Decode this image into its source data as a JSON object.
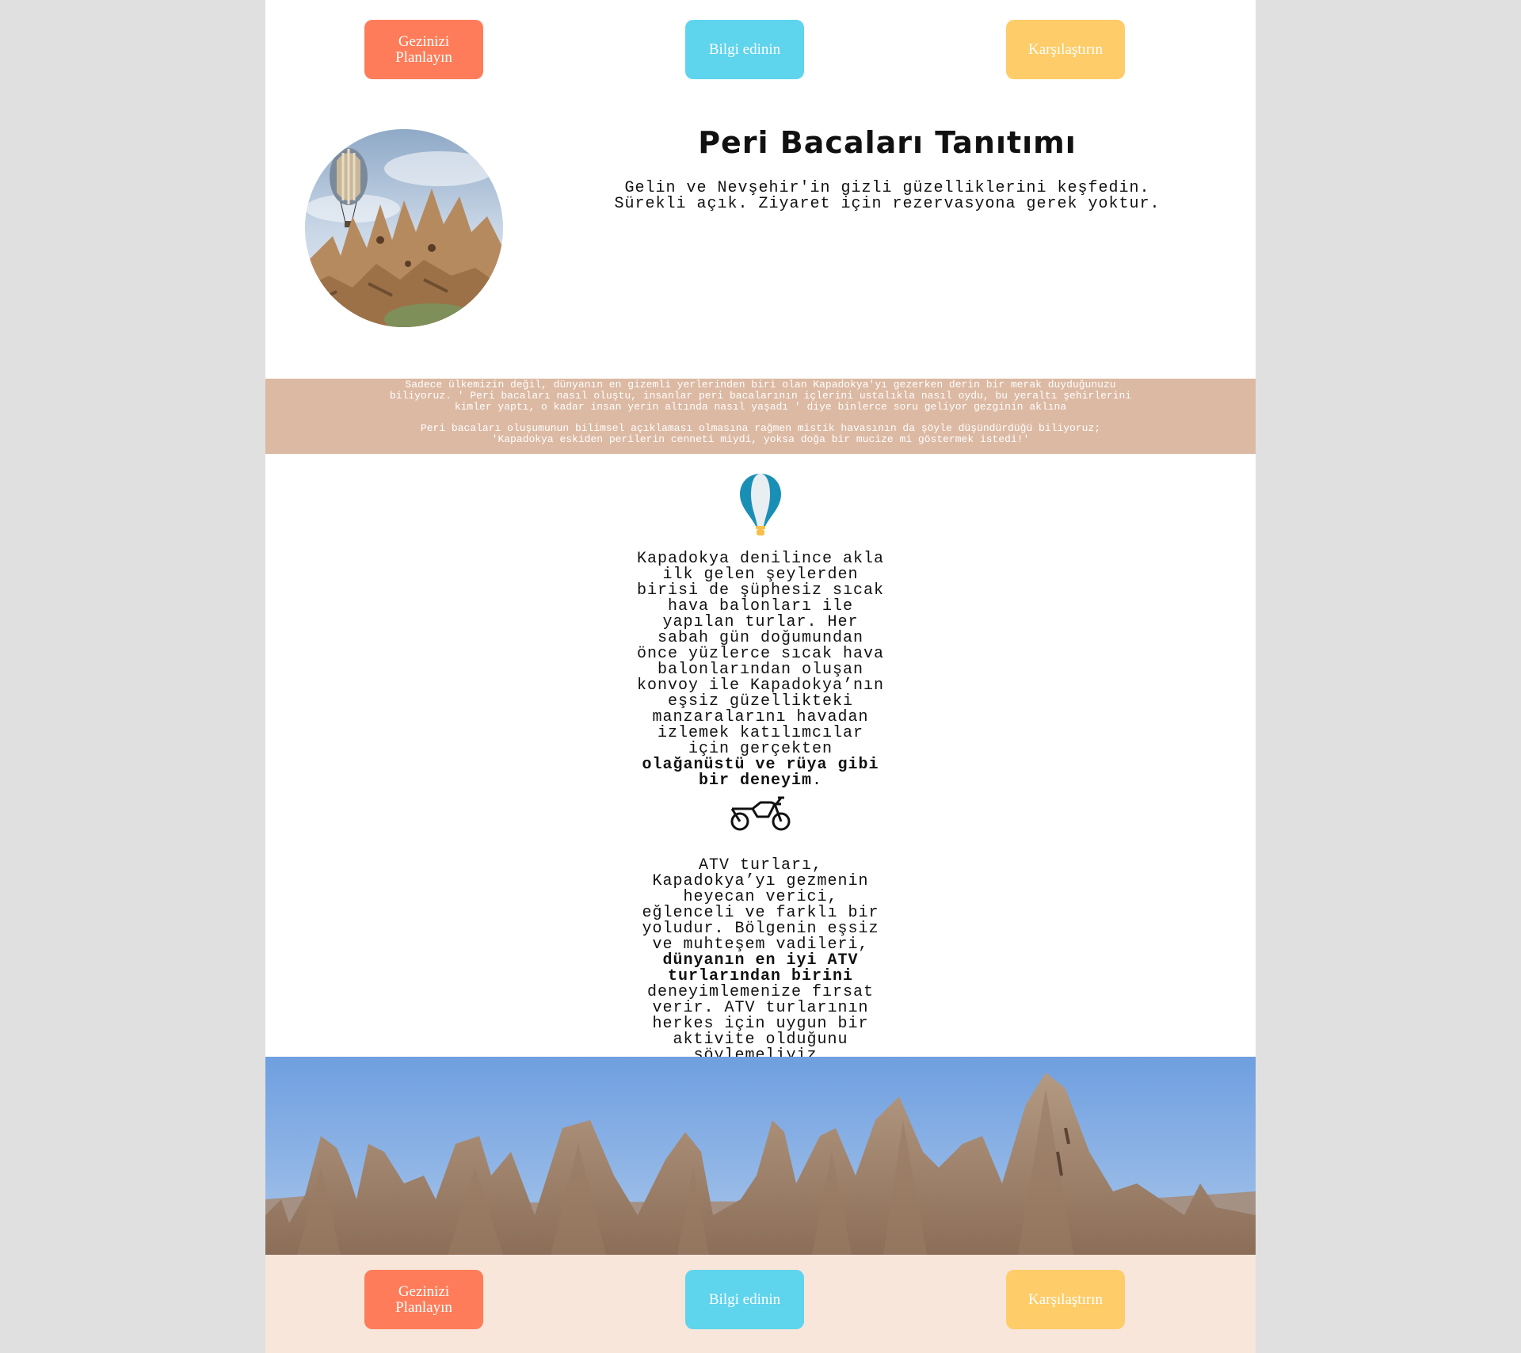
{
  "nav": {
    "plan_label": "Gezinizi Planlayın",
    "info_label": "Bilgi edinin",
    "compare_label": "Karşılaştırın"
  },
  "hero": {
    "title": "Peri Bacaları Tanıtımı",
    "subtitle_line1": "Gelin ve Nevşehir'in gizli güzelliklerini keşfedin.",
    "subtitle_line2": "Sürekli açık. Ziyaret için rezervasyona gerek yoktur.",
    "image_icon": "hot-air-balloon-over-fairy-chimneys"
  },
  "banner": {
    "paragraph1": "Sadece ülkemizin değil, dünyanın en gizemli yerlerinden biri olan Kapadokya'yı gezerken derin bir merak duyduğunuzu biliyoruz. ' Peri bacaları nasıl oluştu, insanlar peri bacalarının içlerini ustalıkla nasıl oydu, bu yeraltı şehirlerini kimler yaptı, o kadar insan yerin altında nasıl yaşadı ' diye binlerce soru geliyor gezginin aklına",
    "paragraph2_line1": "Peri bacaları oluşumunun bilimsel açıklaması olmasına rağmen mistik havasının da şöyle düşündürdüğü biliyoruz;",
    "paragraph2_line2": "'Kapadokya eskiden perilerin cenneti miydi, yoksa doğa bir mucize mi göstermek istedi!'"
  },
  "balloon_section": {
    "icon": "hot-air-balloon-icon",
    "text_before": "Kapadokya denilince akla ilk gelen şeylerden birisi de şüphesiz sıcak hava balonları ile yapılan turlar. Her sabah gün doğumundan önce yüzlerce sıcak hava balonlarından oluşan konvoy ile Kapadokya’nın eşsiz güzellikteki manzaralarını havadan izlemek katılımcılar için gerçekten ",
    "text_bold": "olağanüstü ve rüya gibi bir deneyim",
    "text_after": "."
  },
  "atv_section": {
    "icon": "motorcycle-icon",
    "text_before": "ATV turları, Kapadokya’yı gezmenin heyecan verici, eğlenceli ve farklı bir yoludur. Bölgenin eşsiz ve muhteşem vadileri, ",
    "text_bold": "dünyanın en iyi ATV turlarından birini",
    "text_after": " deneyimlemenize fırsat verir. ATV turlarının herkes için uygun bir aktivite olduğunu söylemeliyiz."
  },
  "colors": {
    "plan_button": "#fe7c59",
    "info_button": "#5ed4ed",
    "compare_button": "#fecc68",
    "banner_bg": "#dcb9a3",
    "footer_bg": "#f8e6da",
    "page_bg": "#e0e0e0"
  }
}
